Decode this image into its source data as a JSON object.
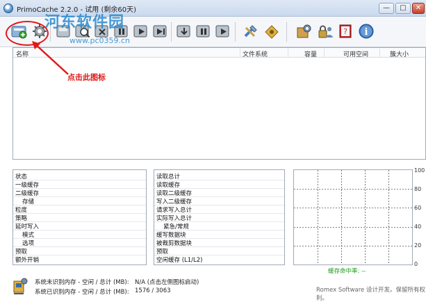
{
  "window": {
    "title": "PrimoCache 2.2.0 - 试用 (剩余60天)",
    "min_glyph": "—",
    "max_glyph": "□",
    "close_glyph": "✕"
  },
  "watermark": {
    "site_name": "河东软件园",
    "url": "www.pc0359.cn"
  },
  "toolbar": {
    "icons": [
      "create-cache-icon",
      "gear-icon",
      "search-icon",
      "delete-icon",
      "pause-icon",
      "play-icon",
      "stop-icon",
      "flush-icon",
      "pause-icon",
      "resume-icon",
      "tools-icon",
      "key-icon",
      "settings-box-icon",
      "lock-user-icon",
      "help-book-icon",
      "info-icon"
    ]
  },
  "list": {
    "columns": [
      "名称",
      "文件系统",
      "容量",
      "可用空间",
      "簇大小"
    ]
  },
  "annotation": {
    "text": "点击此图标",
    "color": "#e01818"
  },
  "left_panel": {
    "rows": [
      "状态",
      "一级缓存",
      "二级缓存",
      "存储",
      "粒度",
      "策略",
      "延时写入",
      "模式",
      "选项",
      "预取",
      "额外开销"
    ]
  },
  "middle_panel": {
    "rows": [
      "读取总计",
      "读取缓存",
      "读取二级缓存",
      "写入二级缓存",
      "请求写入总计",
      "实际写入总计",
      "紧急/常规",
      "缓写数据块",
      "被裁剪数据块",
      "预取",
      "空闲缓存 (L1/L2)"
    ]
  },
  "graph": {
    "y_ticks": [
      "100",
      "80",
      "60",
      "40",
      "20",
      "0"
    ],
    "hit_rate_label": "缓存命中率: --",
    "grid_color": "#555555",
    "hit_color": "#1a9a1a"
  },
  "status": {
    "line1_label": "系统未识别内存 - 空闲 / 总计 (MB):",
    "line1_value": "N/A (点击左侧图标启动)",
    "line2_label": "系统已识别内存 - 空闲 / 总计 (MB):",
    "line2_value": "1576 / 3063",
    "credit": "Romex Software 设计开发。保留所有权利。"
  }
}
